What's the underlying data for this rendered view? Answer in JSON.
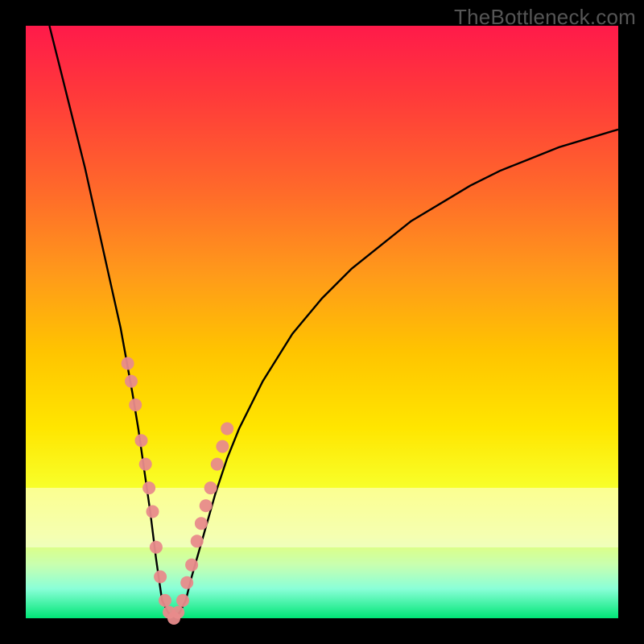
{
  "watermark": "TheBottleneck.com",
  "colors": {
    "frame": "#000000",
    "curve": "#000000",
    "marker": "#e88b8b",
    "gradient_top": "#ff1a4a",
    "gradient_bottom": "#00e676"
  },
  "chart_data": {
    "type": "line",
    "title": "",
    "xlabel": "",
    "ylabel": "",
    "xlim": [
      0,
      100
    ],
    "ylim": [
      0,
      100
    ],
    "series": [
      {
        "name": "bottleneck-curve",
        "x": [
          4,
          6,
          8,
          10,
          12,
          14,
          16,
          18,
          19,
          20,
          21,
          22,
          23,
          24,
          25,
          26,
          27,
          28,
          30,
          32,
          34,
          36,
          40,
          45,
          50,
          55,
          60,
          65,
          70,
          75,
          80,
          85,
          90,
          95,
          100
        ],
        "y": [
          100,
          92,
          84,
          76,
          67,
          58,
          49,
          38,
          32,
          25,
          18,
          10,
          3,
          1,
          0,
          1,
          3,
          7,
          14,
          21,
          27,
          32,
          40,
          48,
          54,
          59,
          63,
          67,
          70,
          73,
          75.5,
          77.5,
          79.5,
          81,
          82.5
        ]
      }
    ],
    "markers": {
      "name": "highlight-points",
      "x": [
        17.2,
        17.8,
        18.5,
        19.5,
        20.2,
        20.8,
        21.4,
        22.0,
        22.7,
        23.5,
        24.2,
        25.0,
        25.7,
        26.5,
        27.2,
        28.0,
        28.9,
        29.6,
        30.4,
        31.2,
        32.3,
        33.2,
        34.0
      ],
      "y": [
        43,
        40,
        36,
        30,
        26,
        22,
        18,
        12,
        7,
        3,
        1,
        0,
        1,
        3,
        6,
        9,
        13,
        16,
        19,
        22,
        26,
        29,
        32
      ]
    },
    "pale_band_y": [
      12,
      22
    ]
  }
}
